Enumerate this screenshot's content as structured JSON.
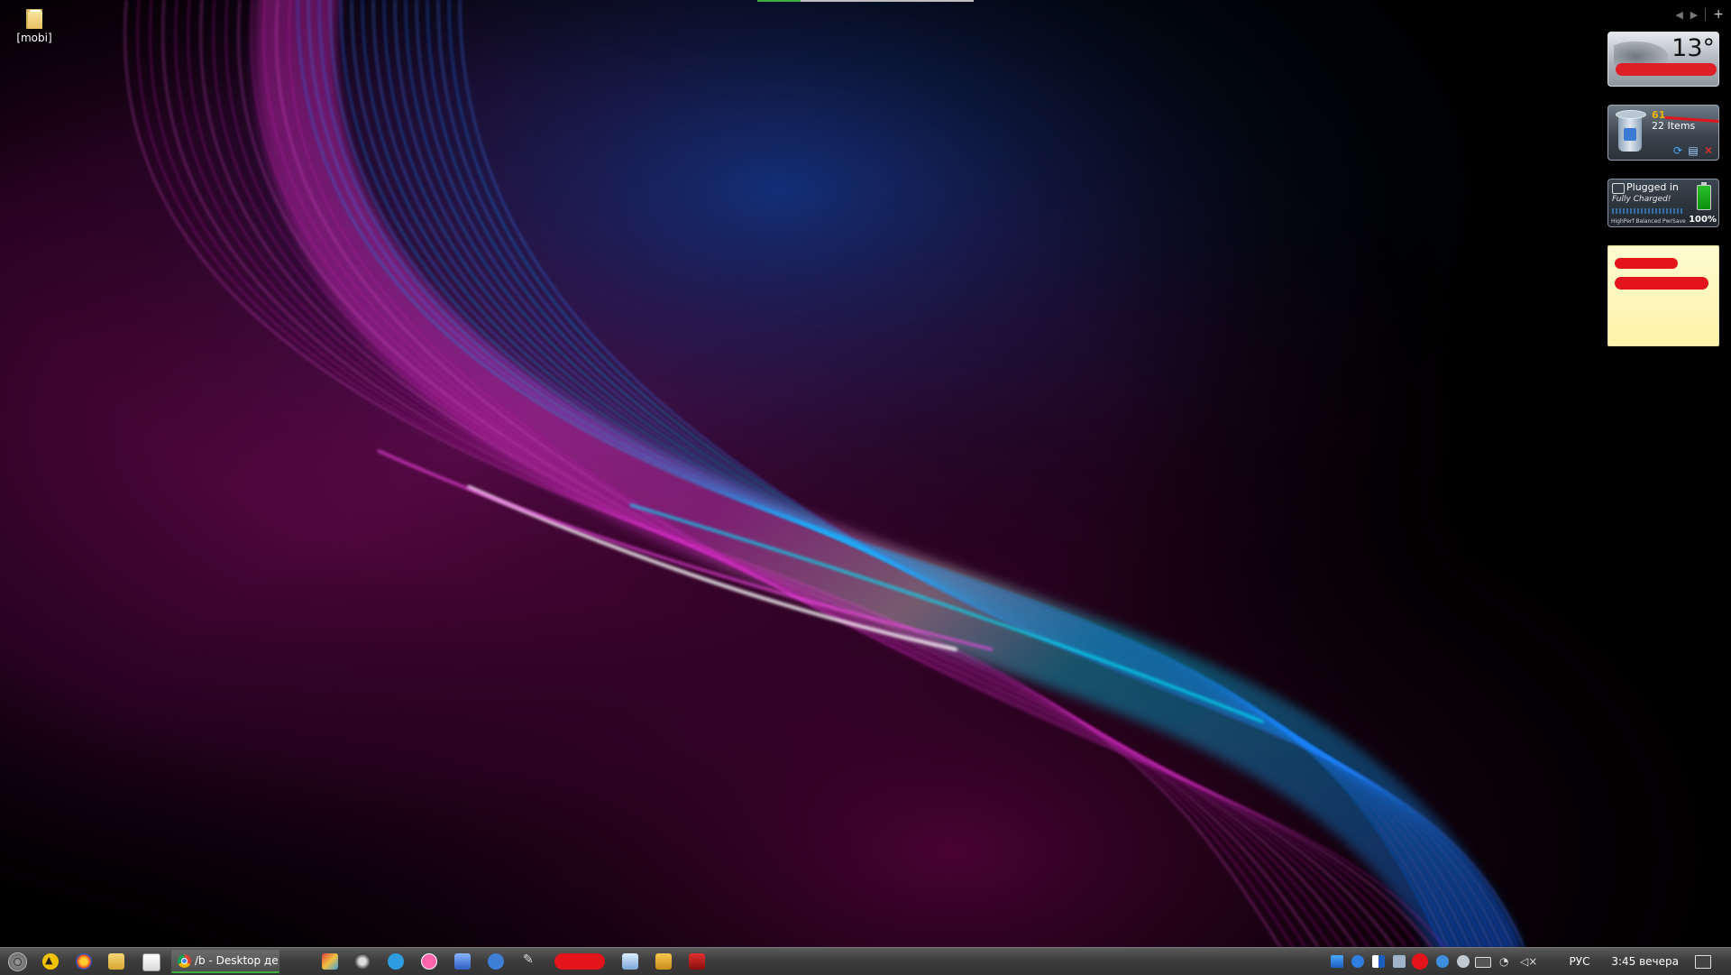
{
  "desktop": {
    "icons": [
      {
        "label": "[mobi]",
        "icon": "folder-icon"
      }
    ]
  },
  "gadgets": {
    "weather": {
      "temperature": "13°",
      "icon": "cloud-icon"
    },
    "recycle_bin": {
      "size": "61.",
      "items": "22 Items",
      "buttons": [
        "refresh-icon",
        "settings-icon",
        "empty-icon"
      ]
    },
    "battery": {
      "status": "Plugged in",
      "charged_text": "Fully Charged!",
      "modes": "HighPerf  Balanced  PwrSave",
      "percent": "100%",
      "level": 1.0
    },
    "sticky_note": {
      "icon": "sticky-note-icon"
    }
  },
  "taskbar": {
    "active_window_title": "/b - Desktop десктоп ...",
    "pinned": [
      "start-orb",
      "avast-icon",
      "yandex-icon",
      "explorer-icon",
      "notes-icon",
      "chrome-icon",
      "paint-icon",
      "steam-icon",
      "skype-icon",
      "osu-icon",
      "monitor-icon",
      "qbittorrent-icon",
      "tool-icon",
      "window-icon",
      "folder-icon",
      "app-icon"
    ],
    "tray": {
      "language": "РУС",
      "time": "3:45 вечера"
    }
  },
  "colors": {
    "taskbar": "#3d3d3d",
    "accent_green": "#3fae3f",
    "redaction": "#e3141a",
    "wave_magenta": "#ff2ee0",
    "wave_cyan": "#00e8ff",
    "wave_blue": "#1a6cff"
  }
}
